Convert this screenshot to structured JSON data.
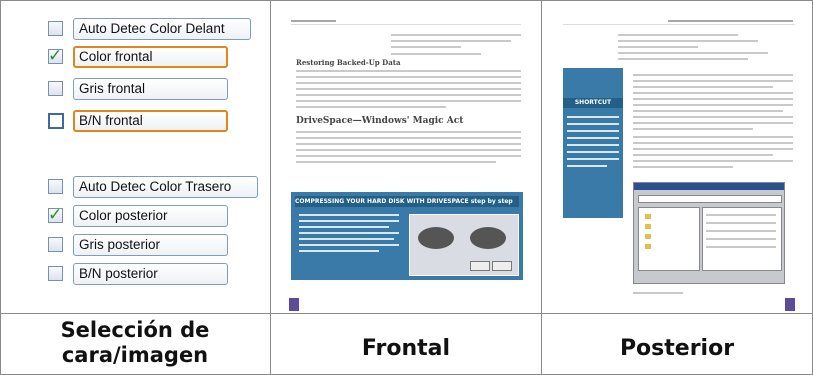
{
  "options": [
    {
      "label": "Auto Detec Color Delant",
      "checked": false
    },
    {
      "label": "Color frontal",
      "checked": true
    },
    {
      "label": "Gris frontal",
      "checked": false
    },
    {
      "label": "B/N frontal",
      "checked": false
    },
    {
      "label": "Auto Detec Color Trasero",
      "checked": false
    },
    {
      "label": "Color posterior",
      "checked": true
    },
    {
      "label": "Gris posterior",
      "checked": false
    },
    {
      "label": "B/N posterior",
      "checked": false
    }
  ],
  "captions": {
    "selection_line1": "Selección de",
    "selection_line2": "cara/imagen",
    "front": "Frontal",
    "back": "Posterior"
  },
  "front_page": {
    "heading1": "Restoring Backed-Up Data",
    "heading2": "DriveSpace—Windows' Magic Act",
    "banner": "COMPRESSING YOUR HARD DISK WITH DRIVESPACE step by step"
  },
  "back_page": {
    "sidebar_title": "SHORTCUT"
  },
  "colors": {
    "orange_highlight": "#e0861a",
    "check_green": "#2e8b2e",
    "banner_blue": "#3a7aa8",
    "page_tab_purple": "#5b4b9a"
  }
}
